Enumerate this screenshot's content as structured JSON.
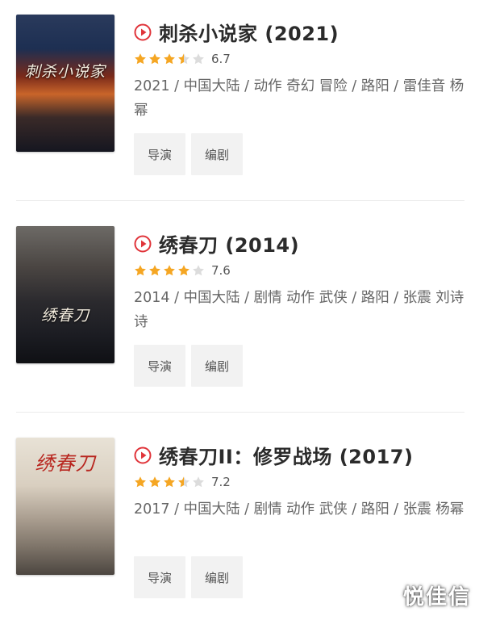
{
  "movies": [
    {
      "title": "刺杀小说家 (2021)",
      "rating": 6.7,
      "rating_text": "6.7",
      "stars": [
        "full",
        "full",
        "full",
        "half",
        "empty"
      ],
      "meta": "2021 / 中国大陆 / 动作 奇幻 冒险 / 路阳 / 雷佳音 杨幂",
      "poster_text": "刺杀小说家",
      "buttons": [
        "导演",
        "编剧"
      ]
    },
    {
      "title": "绣春刀 (2014)",
      "rating": 7.6,
      "rating_text": "7.6",
      "stars": [
        "full",
        "full",
        "full",
        "full",
        "empty"
      ],
      "meta": "2014 / 中国大陆 / 剧情 动作 武侠 / 路阳 / 张震 刘诗诗",
      "poster_text": "绣春刀",
      "buttons": [
        "导演",
        "编剧"
      ]
    },
    {
      "title": "绣春刀II：修罗战场 (2017)",
      "rating": 7.2,
      "rating_text": "7.2",
      "stars": [
        "full",
        "full",
        "full",
        "half",
        "empty"
      ],
      "meta": "2017 / 中国大陆 / 剧情 动作 武侠 / 路阳 / 张震 杨幂",
      "poster_text": "绣春刀",
      "buttons": [
        "导演",
        "编剧"
      ]
    }
  ],
  "watermark": "悦佳信",
  "colors": {
    "accent": "#e0343a",
    "star": "#f5a623",
    "star_empty": "#dcdcdc"
  }
}
